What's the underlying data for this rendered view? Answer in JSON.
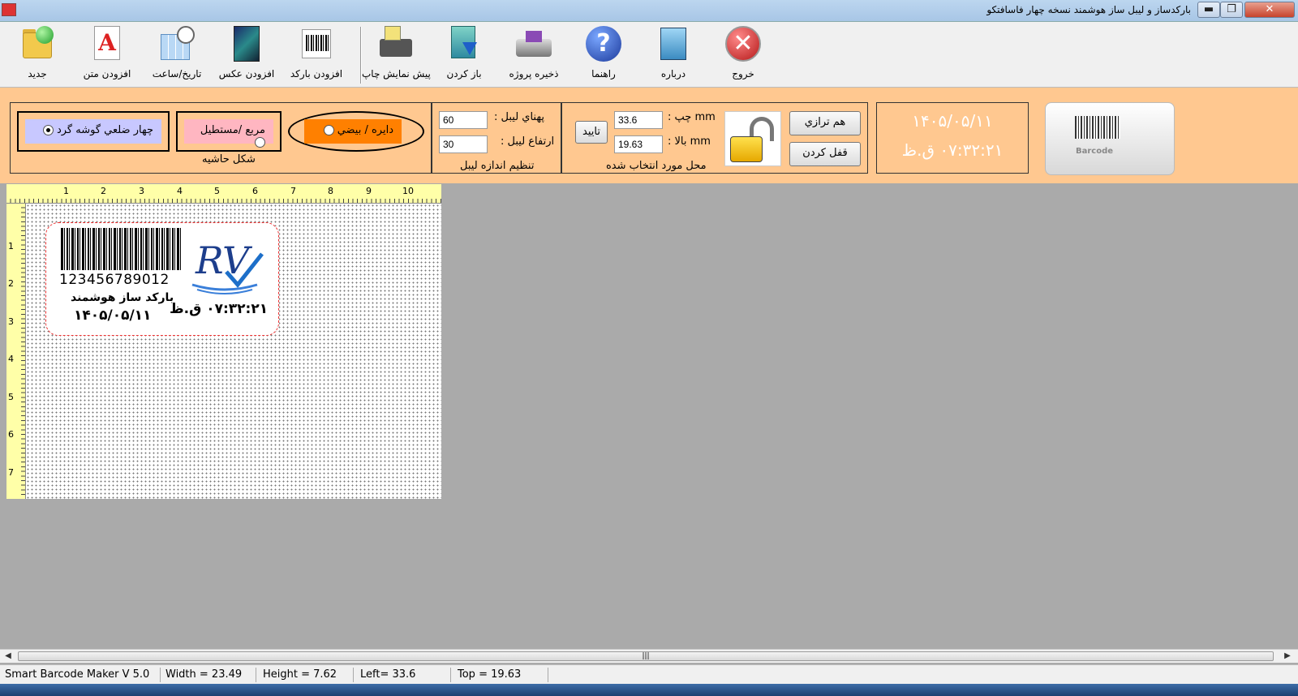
{
  "window": {
    "title": "بارکدساز و ليبل ساز هوشمند نسخه چهار فاسافتکو",
    "min_glyph": "▬",
    "max_glyph": "❐",
    "close_glyph": "✕"
  },
  "toolbar": {
    "items": [
      {
        "label": "جديد",
        "icon": "folder-new-icon"
      },
      {
        "label": "افزودن متن",
        "icon": "text-icon"
      },
      {
        "label": "تاريخ/ساعت",
        "icon": "calendar-clock-icon"
      },
      {
        "label": "افزودن عکس",
        "icon": "image-icon"
      },
      {
        "label": "افزودن بارکد",
        "icon": "barcode-icon"
      },
      {
        "label": "پيش نمايش چاپ",
        "icon": "print-preview-icon"
      },
      {
        "label": "باز کردن",
        "icon": "open-icon"
      },
      {
        "label": "ذخيره پروژه",
        "icon": "save-icon"
      },
      {
        "label": "راهنما",
        "icon": "help-icon"
      },
      {
        "label": "درباره",
        "icon": "about-icon"
      },
      {
        "label": "خروج",
        "icon": "exit-icon"
      }
    ]
  },
  "shape": {
    "caption": "شکل حاشيه",
    "round_label": "چهار ضلعي گوشه گرد",
    "rect_label": "مربع /مستطيل",
    "ellipse_label": "دايره / بيضي",
    "selected": "round"
  },
  "size": {
    "caption": "تنظيم اندازه ليبل",
    "width_label": "پهناي ليبل :",
    "width_value": "60",
    "height_label": "ارتفاع ليبل :",
    "height_value": "30"
  },
  "position": {
    "caption": "محل مورد انتخاب شده",
    "left_label": "mm  چپ :",
    "left_value": "33.6",
    "top_label": "mm  بالا :",
    "top_value": "19.63",
    "confirm_label": "تاييد",
    "align_label": "هم ترازي",
    "lock_label": "قفل کردن"
  },
  "datetime": {
    "date": "۱۴۰۵/۰۵/۱۱",
    "time": "۰۷:۳۲:۲۱ ق.ظ"
  },
  "brand_logo_text": "Barcode",
  "ruler": {
    "top_ticks": [
      "1",
      "2",
      "3",
      "4",
      "5",
      "6",
      "7",
      "8",
      "9",
      "10"
    ],
    "left_ticks": [
      "1",
      "2",
      "3",
      "4",
      "5",
      "6",
      "7"
    ]
  },
  "label": {
    "barcode_number": "123456789012",
    "name": "بارکد ساز هوشمند",
    "date": "۱۴۰۵/۰۵/۱۱",
    "time": "۰۷:۳۲:۲۱ ق.ظ",
    "logo_text": "RV"
  },
  "scrollbar": {
    "grip": "|||",
    "left_arrow": "◀",
    "right_arrow": "▶"
  },
  "status": {
    "app": "Smart Barcode Maker V 5.0",
    "width": "Width = 23.49",
    "height": "Height = 7.62",
    "left": "Left= 33.6",
    "top": "Top = 19.63"
  }
}
